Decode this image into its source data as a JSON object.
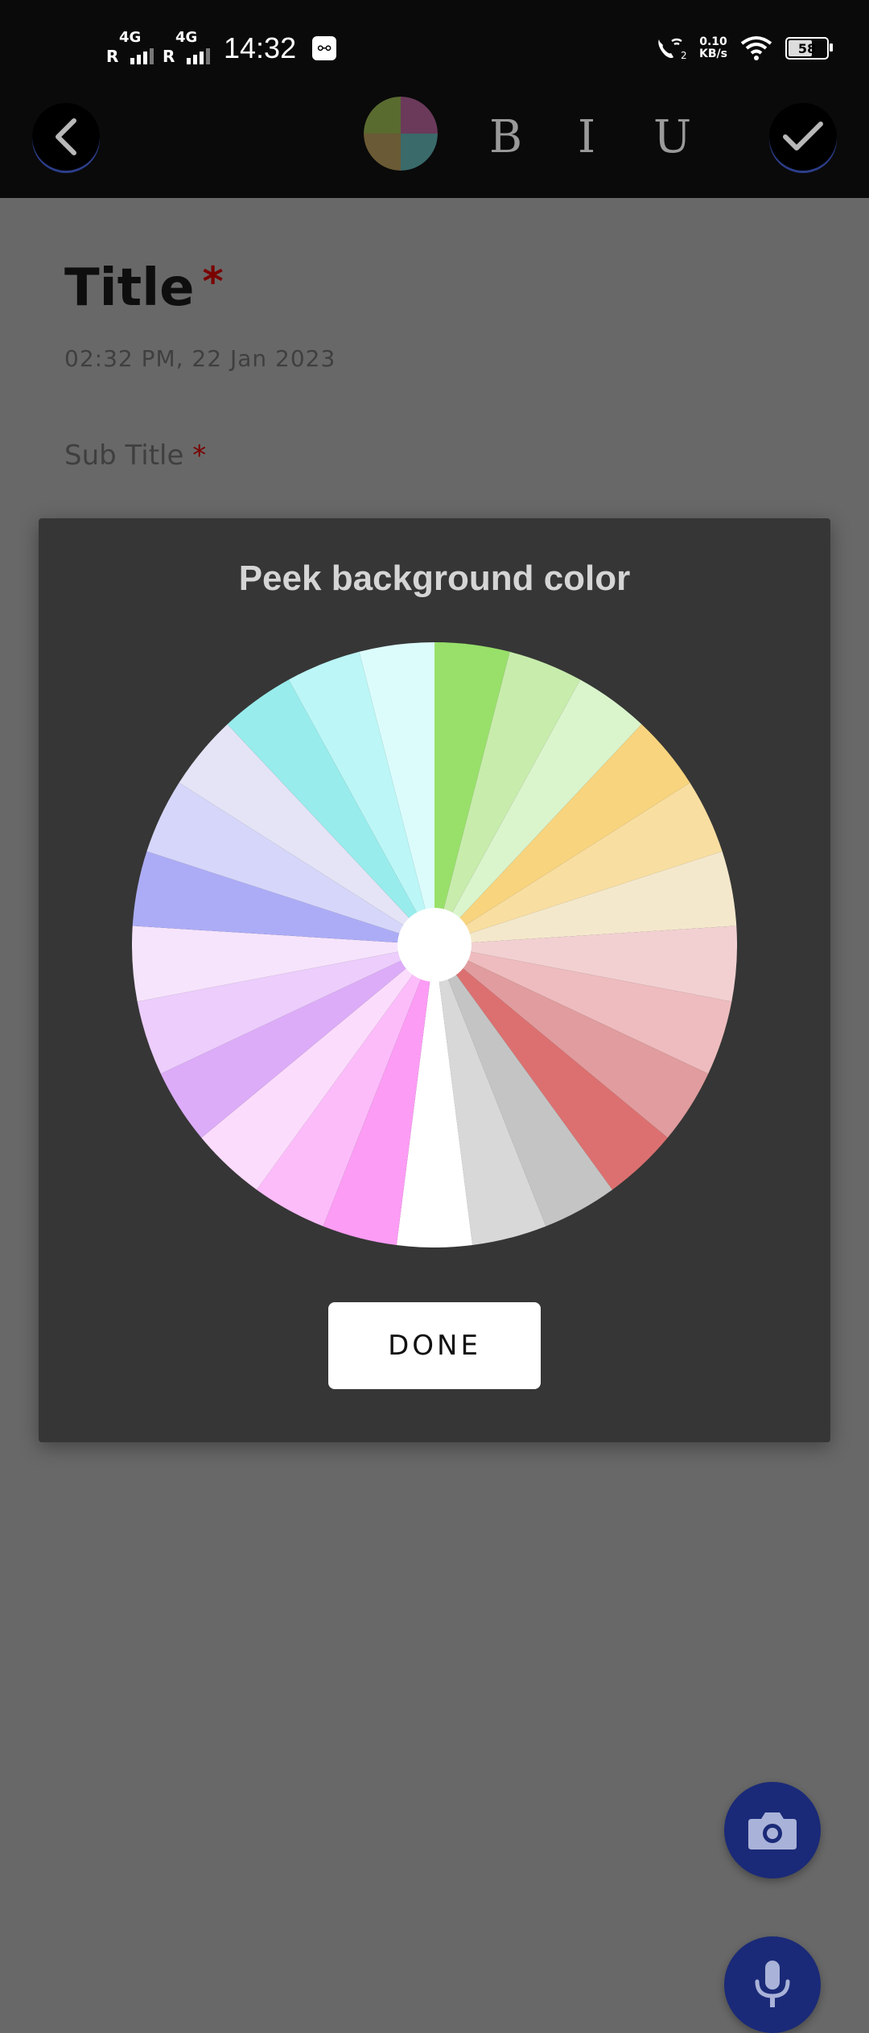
{
  "status_bar": {
    "sim1_roaming": "R",
    "sim1_network": "4G",
    "sim2_roaming": "R",
    "sim2_network": "4G",
    "time": "14:32",
    "net_speed_value": "0.10",
    "net_speed_unit": "KB/s",
    "battery_level": "58"
  },
  "toolbar": {
    "bold_label": "B",
    "italic_label": "I",
    "underline_label": "U",
    "swatch_colors": [
      "#5a6b30",
      "#6b3a5a",
      "#6a5a35",
      "#3a6a6a"
    ]
  },
  "note": {
    "title": "Title",
    "title_required_mark": "*",
    "date": "02:32 PM, 22 Jan 2023",
    "subtitle": "Sub Title",
    "subtitle_required_mark": "*"
  },
  "dialog": {
    "title": "Peek background color",
    "done_label": "DONE",
    "wheel_colors": [
      "#98e06a",
      "#c8ecac",
      "#daf4cc",
      "#f8d47e",
      "#f8dea0",
      "#f4e8cc",
      "#f2d0d2",
      "#eebcbe",
      "#e09c9e",
      "#dc7070",
      "#c4c4c4",
      "#d8d8d8",
      "#ffffff",
      "#fc9cf4",
      "#fcbcfa",
      "#fcdcfc",
      "#dcacf8",
      "#eccdfc",
      "#f6e4fc",
      "#acacf6",
      "#d6d6fa",
      "#e4e4f6",
      "#98ecec",
      "#bcf6f6",
      "#dcfcfc"
    ]
  },
  "fabs": {
    "camera_icon": "camera-icon",
    "mic_icon": "microphone-icon"
  }
}
